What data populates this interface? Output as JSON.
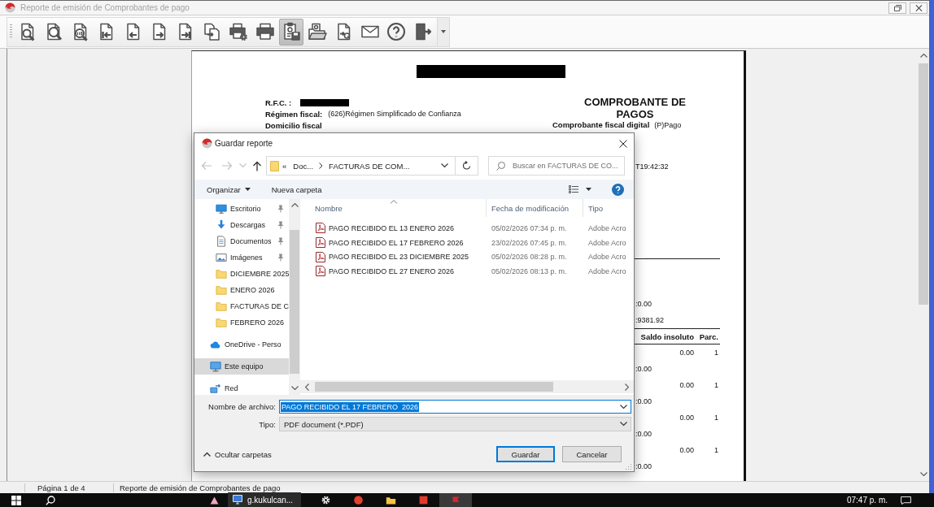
{
  "window": {
    "title": "Reporte de emisión de Comprobantes de pago"
  },
  "toolbar": {
    "buttons": [
      {
        "kind": "zoompage",
        "pressed": false
      },
      {
        "kind": "zoomwidth",
        "pressed": false
      },
      {
        "kind": "zoom100",
        "pressed": false
      },
      {
        "kind": "first",
        "pressed": false
      },
      {
        "kind": "prev",
        "pressed": false
      },
      {
        "kind": "next",
        "pressed": false
      },
      {
        "kind": "last",
        "pressed": false
      },
      {
        "kind": "goto",
        "pressed": false
      },
      {
        "kind": "printsetup",
        "pressed": false
      },
      {
        "kind": "print",
        "pressed": false
      },
      {
        "kind": "save",
        "pressed": true
      },
      {
        "kind": "open",
        "pressed": false
      },
      {
        "kind": "export",
        "pressed": false
      },
      {
        "kind": "email",
        "pressed": false
      },
      {
        "kind": "help",
        "pressed": false
      },
      {
        "kind": "exit",
        "pressed": false
      }
    ]
  },
  "document": {
    "header": {
      "redacted": true
    },
    "rfc": {
      "label": "R.F.C. :",
      "redacted": true
    },
    "regime": {
      "label": "Régimen fiscal:",
      "value": "(626)Régimen Simplificado de Confianza"
    },
    "address": {
      "label": "Domicilio fiscal"
    },
    "title": "COMPROBANTE DE PAGOS",
    "cfdi_type": {
      "label": "Comprobante fiscal digital",
      "value": "(P)Pago"
    },
    "date_fragment": "T19:42:32",
    "totals": [
      ":0.00",
      ":9381.92"
    ],
    "payments": {
      "columns": [
        "Saldo insoluto",
        "Parc."
      ],
      "rows": [
        {
          "balance": "0.00",
          "installment": "1",
          "note": ":0.00"
        },
        {
          "balance": "0.00",
          "installment": "1",
          "note": ":0.00"
        },
        {
          "balance": "0.00",
          "installment": "1",
          "note": ":0.00"
        },
        {
          "balance": "0.00",
          "installment": "1",
          "note": ":0.00"
        }
      ]
    }
  },
  "dialog": {
    "title": "Guardar reporte",
    "address": {
      "overflow": "«",
      "segments": [
        "Doc...",
        "FACTURAS DE COM..."
      ]
    },
    "search": {
      "placeholder": "Buscar en FACTURAS DE CO..."
    },
    "commands": {
      "organize": "Organizar",
      "new_folder": "Nueva carpeta"
    },
    "nav": [
      {
        "children": [
          {
            "label": "Escritorio",
            "kind": "desktop",
            "pinned": true,
            "selected": false
          },
          {
            "label": "Descargas",
            "kind": "downloads",
            "pinned": true,
            "selected": false
          },
          {
            "label": "Documentos",
            "kind": "documents",
            "pinned": true,
            "selected": false
          },
          {
            "label": "Imágenes",
            "kind": "pictures",
            "pinned": true,
            "selected": false
          },
          {
            "label": "DICIEMBRE 2025",
            "kind": "folder",
            "pinned": false,
            "selected": false
          },
          {
            "label": "ENERO 2026",
            "kind": "folder",
            "pinned": false,
            "selected": false
          },
          {
            "label": "FACTURAS DE C",
            "kind": "folder",
            "pinned": false,
            "selected": false
          },
          {
            "label": "FEBRERO 2026",
            "kind": "folder",
            "pinned": false,
            "selected": false
          }
        ]
      },
      {
        "label": "OneDrive - Perso",
        "kind": "cloud",
        "pinned": false,
        "selected": false
      },
      {
        "label": "Este equipo",
        "kind": "computer",
        "pinned": false,
        "selected": true
      },
      {
        "label": "Red",
        "kind": "network",
        "pinned": false,
        "selected": false
      }
    ],
    "columns": [
      {
        "label": "Nombre",
        "sorted": true
      },
      {
        "label": "Fecha de modificación",
        "sorted": false
      },
      {
        "label": "Tipo",
        "sorted": false
      }
    ],
    "files": [
      {
        "name": "PAGO RECIBIDO EL 13 ENERO 2026",
        "modified": "05/02/2026 07:34 p. m.",
        "type": "Adobe Acro",
        "selected": false
      },
      {
        "name": "PAGO RECIBIDO EL 17 FEBRERO 2026",
        "modified": "23/02/2026 07:45 p. m.",
        "type": "Adobe Acro",
        "selected": false
      },
      {
        "name": "PAGO RECIBIDO EL 23 DICIEMBRE 2025",
        "modified": "05/02/2026 08:28 p. m.",
        "type": "Adobe Acro",
        "selected": false
      },
      {
        "name": "PAGO RECIBIDO EL 27 ENERO 2026",
        "modified": "05/02/2026 08:13 p. m.",
        "type": "Adobe Acro",
        "selected": false
      }
    ],
    "filename": {
      "label": "Nombre de archivo:",
      "value": "PAGO RECIBIDO EL 17 FEBRERO  2026",
      "selected": true,
      "focused": true
    },
    "filetype": {
      "label": "Tipo:",
      "value": "PDF document (*.PDF)",
      "focused": false
    },
    "toggle_folders": "Ocultar carpetas",
    "buttons": [
      {
        "label": "Guardar",
        "default": true
      },
      {
        "label": "Cancelar",
        "default": false
      }
    ]
  },
  "status_bar": {
    "page": "Página 1 de 4",
    "report": "Reporte de emisión de Comprobantes de pago"
  },
  "taskbar": {
    "apps": [
      {
        "kind": "triangle",
        "active": false
      },
      {
        "kind": "gear",
        "active": false
      },
      {
        "kind": "circle",
        "active": false
      },
      {
        "kind": "folder",
        "active": false
      },
      {
        "kind": "square",
        "active": false
      },
      {
        "kind": "flag",
        "active": true
      }
    ],
    "preview": {
      "label": "g.kukulcan..."
    },
    "clock": "07:47 p. m."
  }
}
